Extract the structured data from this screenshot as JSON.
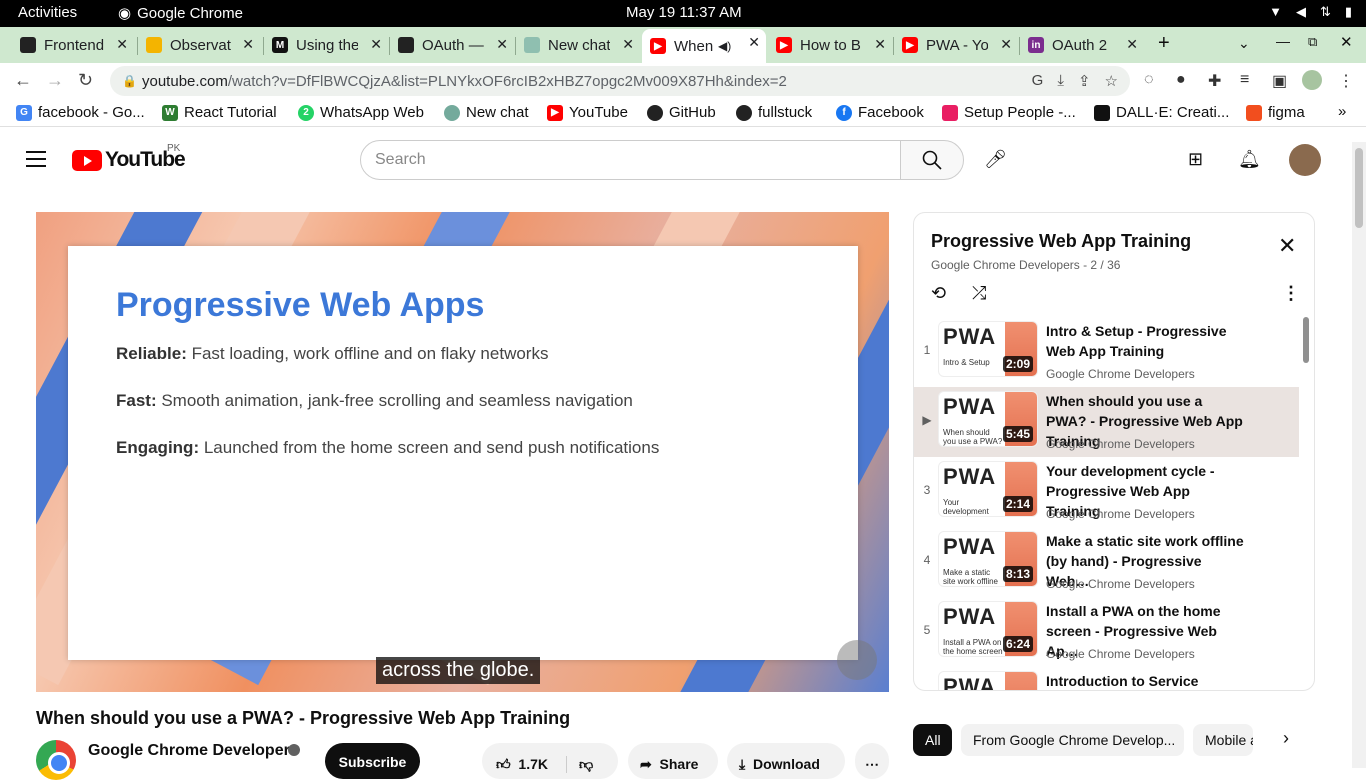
{
  "system": {
    "activities": "Activities",
    "app": "Google Chrome",
    "clock": "May 19  11:37 AM"
  },
  "tabs": [
    {
      "title": "Frontend",
      "color": "#222"
    },
    {
      "title": "Observat",
      "color": "#f4b400"
    },
    {
      "title": "Using the",
      "color": "#111"
    },
    {
      "title": "OAuth —",
      "color": "#222"
    },
    {
      "title": "New chat",
      "color": "#8fbfb0"
    },
    {
      "title": "When",
      "color": "#ff0000"
    },
    {
      "title": "How to B",
      "color": "#ff0000"
    },
    {
      "title": "PWA - Yo",
      "color": "#ff0000"
    },
    {
      "title": "OAuth 2",
      "color": "#7b2d8e"
    }
  ],
  "omnibox": {
    "host": "youtube.com",
    "path": "/watch?v=DfFlBWCQjzA&list=PLNYkxOF6rcIB2xHBZ7opgc2Mv009X87Hh&index=2"
  },
  "bookmarks": [
    {
      "label": "facebook - Go...",
      "icon": "G",
      "color": "#4285f4"
    },
    {
      "label": "React Tutorial",
      "icon": "W",
      "color": "#2e7d32"
    },
    {
      "label": "WhatsApp Web",
      "icon": "2",
      "color": "#25d366"
    },
    {
      "label": "New chat",
      "icon": "⊛",
      "color": "#74aa9c"
    },
    {
      "label": "YouTube",
      "icon": "▶",
      "color": "#ff0000"
    },
    {
      "label": "GitHub",
      "icon": "●",
      "color": "#222"
    },
    {
      "label": "fullstuck",
      "icon": "●",
      "color": "#222"
    },
    {
      "label": "Facebook",
      "icon": "f",
      "color": "#1877f2"
    },
    {
      "label": "Setup People -...",
      "icon": "✱",
      "color": "#e91e63"
    },
    {
      "label": "DALL·E: Creati...",
      "icon": "⊛",
      "color": "#111"
    },
    {
      "label": "figma",
      "icon": "F",
      "color": "#f24e1e"
    }
  ],
  "youtube": {
    "country": "PK",
    "search_placeholder": "Search",
    "logo_text": "YouTube"
  },
  "slide": {
    "heading": "Progressive Web Apps",
    "lines": [
      {
        "label": "Reliable:",
        "text": " Fast loading, work offline and on flaky networks"
      },
      {
        "label": "Fast:",
        "text": " Smooth animation, jank-free scrolling and seamless navigation"
      },
      {
        "label": "Engaging:",
        "text": " Launched from the home screen and send push notifications"
      }
    ],
    "caption": "across the globe."
  },
  "video": {
    "title": "When should you use a PWA? - Progressive Web App Training",
    "channel": "Google Chrome Developers",
    "subscribe": "Subscribe",
    "likes": "1.7K",
    "share": "Share",
    "download": "Download"
  },
  "playlist": {
    "title": "Progressive Web App Training",
    "subtitle": "Google Chrome Developers - 2 / 36",
    "items": [
      {
        "index": "1",
        "title": "Intro & Setup - Progressive Web App Training",
        "channel": "Google Chrome Developers",
        "duration": "2:09",
        "thumb_text": "Intro & Setup"
      },
      {
        "index": "▶",
        "title": "When should you use a PWA? - Progressive Web App Training",
        "channel": "Google Chrome Developers",
        "duration": "5:45",
        "thumb_text": "When should you use a PWA?"
      },
      {
        "index": "3",
        "title": "Your development cycle - Progressive Web App Training",
        "channel": "Google Chrome Developers",
        "duration": "2:14",
        "thumb_text": "Your development cycle"
      },
      {
        "index": "4",
        "title": "Make a static site work offline (by hand) - Progressive Web…",
        "channel": "Google Chrome Developers",
        "duration": "8:13",
        "thumb_text": "Make a static site work offline (by hand)"
      },
      {
        "index": "5",
        "title": "Install a PWA on the home screen - Progressive Web Ap…",
        "channel": "Google Chrome Developers",
        "duration": "6:24",
        "thumb_text": "Install a PWA on the home screen"
      },
      {
        "index": "",
        "title": "Introduction to Service Worker",
        "channel": "",
        "duration": "",
        "thumb_text": ""
      }
    ]
  },
  "chips": [
    "All",
    "From Google Chrome Develop...",
    "Mobile ap"
  ]
}
